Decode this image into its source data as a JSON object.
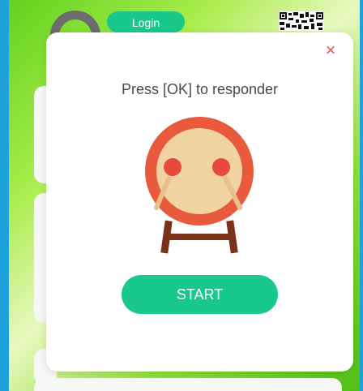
{
  "background": {
    "login_label": "Login",
    "icons": {
      "avatar": "avatar-icon",
      "qr": "qr-code-icon"
    }
  },
  "dialog": {
    "close_label": "×",
    "prompt": "Press [OK] to responder",
    "start_label": "START",
    "illustration": "drum-icon"
  },
  "colors": {
    "accent": "#19c98c",
    "close": "#e35a5a",
    "frame": "#1da2dc",
    "drum_rim": "#e9593b",
    "drum_face": "#f1d3a2",
    "drum_stand": "#7a3019"
  }
}
